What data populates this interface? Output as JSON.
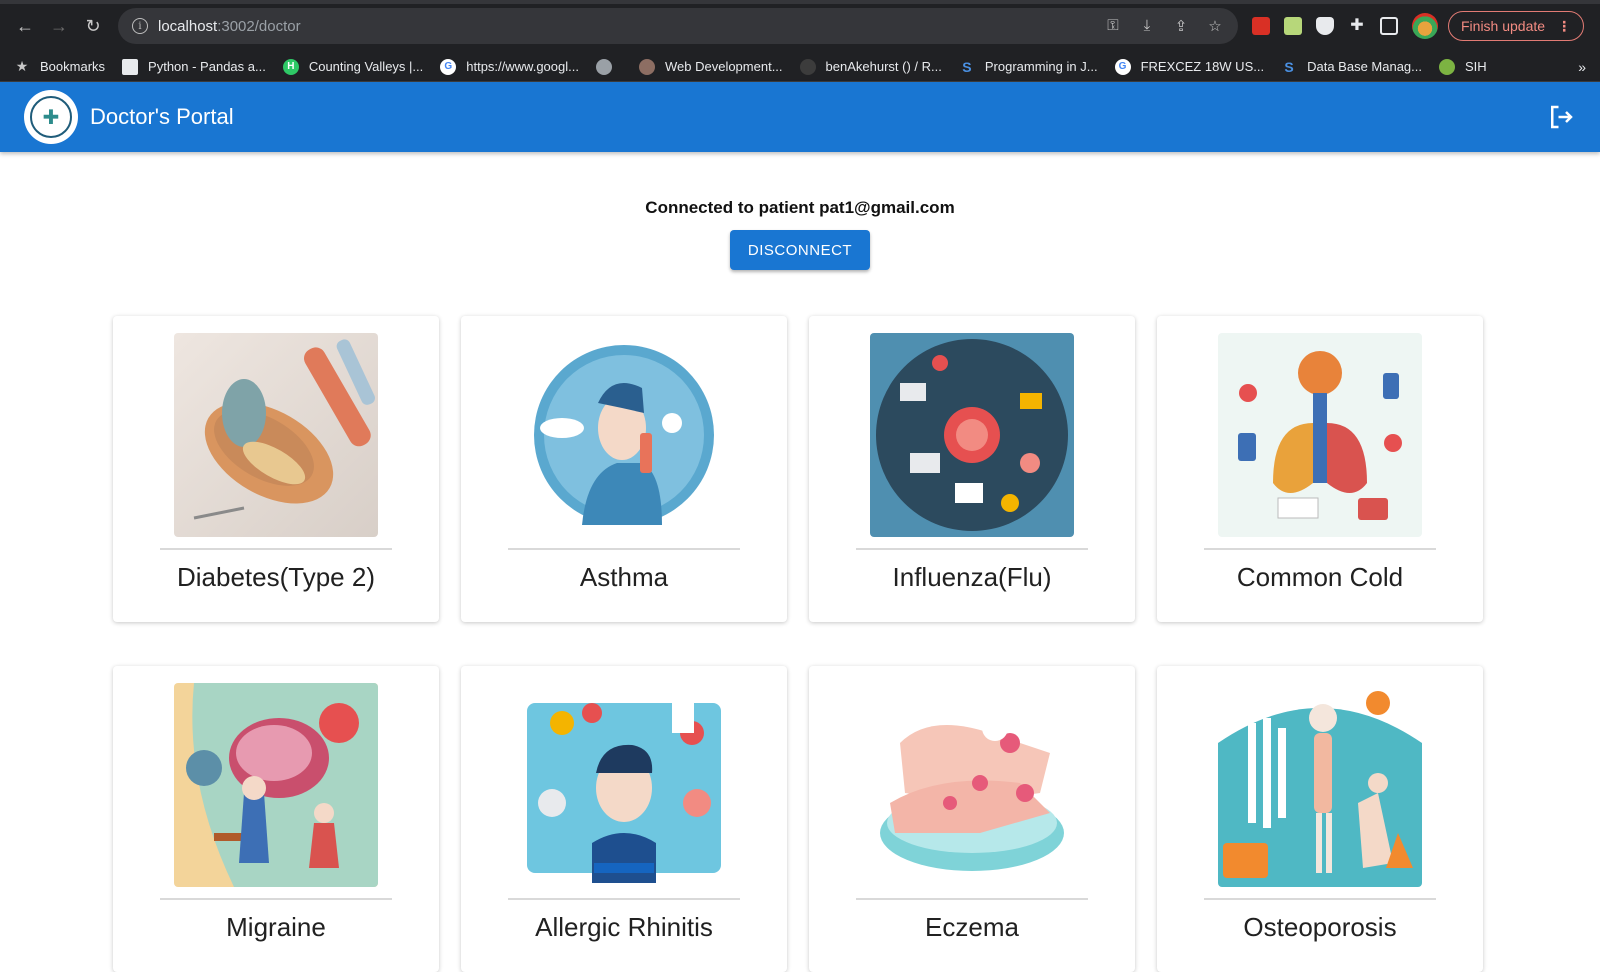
{
  "browser": {
    "url_host": "localhost",
    "url_path": ":3002/doctor",
    "finish_update": "Finish update",
    "bookmarks": [
      {
        "label": "Bookmarks",
        "icon": "star-icon"
      },
      {
        "label": "Python - Pandas a...",
        "icon": "geeks-icon"
      },
      {
        "label": "Counting Valleys |...",
        "icon": "hackerrank-icon"
      },
      {
        "label": "https://www.googl...",
        "icon": "google-icon"
      },
      {
        "label": "",
        "icon": "globe-icon"
      },
      {
        "label": "Web Development...",
        "icon": "owl-icon"
      },
      {
        "label": "benAkehurst () / R...",
        "icon": "github-icon"
      },
      {
        "label": "Programming in J...",
        "icon": "s-icon"
      },
      {
        "label": "FREXCEZ 18W US...",
        "icon": "google-icon"
      },
      {
        "label": "Data Base Manag...",
        "icon": "s-icon"
      },
      {
        "label": "SIH",
        "icon": "leaf-icon"
      }
    ],
    "more": "»"
  },
  "app": {
    "title": "Doctor's Portal"
  },
  "connection": {
    "status": "Connected to patient pat1@gmail.com",
    "disconnect_label": "DISCONNECT"
  },
  "diseases": [
    {
      "label": "Diabetes(Type 2)",
      "image": "pancreas-illustration"
    },
    {
      "label": "Asthma",
      "image": "inhaler-illustration"
    },
    {
      "label": "Influenza(Flu)",
      "image": "virus-illustration"
    },
    {
      "label": "Common Cold",
      "image": "lungs-illustration"
    },
    {
      "label": "Migraine",
      "image": "brain-illustration"
    },
    {
      "label": "Allergic Rhinitis",
      "image": "rhinitis-illustration"
    },
    {
      "label": "Eczema",
      "image": "hands-illustration"
    },
    {
      "label": "Osteoporosis",
      "image": "skeleton-illustration"
    }
  ],
  "colors": {
    "appbar": "#1976d2",
    "button": "#1976d2"
  }
}
